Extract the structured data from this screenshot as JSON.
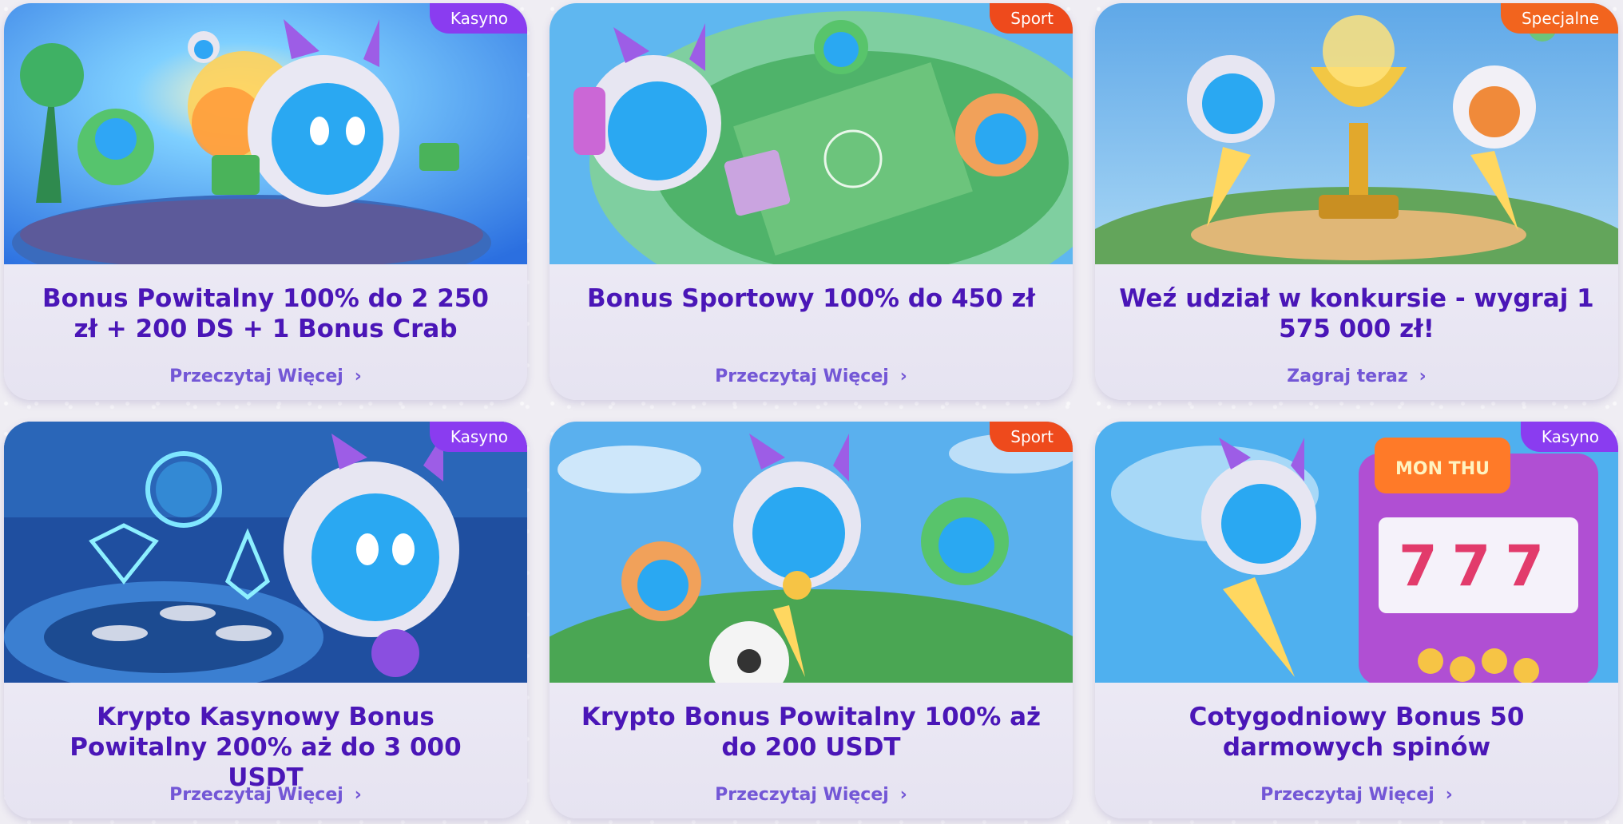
{
  "colors": {
    "title": "#4a16b7",
    "link": "#7357d6",
    "tag_kasyno": "#8a3cf0",
    "tag_sport": "#ee4a1c",
    "tag_specjalne": "#f2641e"
  },
  "cards": [
    {
      "tag": "Kasyno",
      "title": "Bonus Powitalny 100% do 2 250 zł + 200 DS + 1 Bonus Crab",
      "link": "Przeczytaj Więcej",
      "chevron_icon": "chevron-right-icon"
    },
    {
      "tag": "Sport",
      "title": "Bonus Sportowy 100% do 450 zł",
      "link": "Przeczytaj Więcej",
      "chevron_icon": "chevron-right-icon"
    },
    {
      "tag": "Specjalne",
      "title": "Weź udział w konkursie - wygraj 1 575 000 zł!",
      "link": "Zagraj teraz",
      "chevron_icon": "chevron-right-icon"
    },
    {
      "tag": "Kasyno",
      "title": "Krypto Kasynowy Bonus Powitalny 200% aż do 3 000 USDT",
      "link": "Przeczytaj Więcej",
      "chevron_icon": "chevron-right-icon"
    },
    {
      "tag": "Sport",
      "title": "Krypto Bonus Powitalny 100% aż do 200 USDT",
      "link": "Przeczytaj Więcej",
      "chevron_icon": "chevron-right-icon"
    },
    {
      "tag": "Kasyno",
      "title": "Cotygodniowy Bonus 50 darmowych spinów",
      "link": "Przeczytaj Więcej",
      "chevron_icon": "chevron-right-icon",
      "art_text": "MON THU",
      "art_reels": "777"
    }
  ]
}
